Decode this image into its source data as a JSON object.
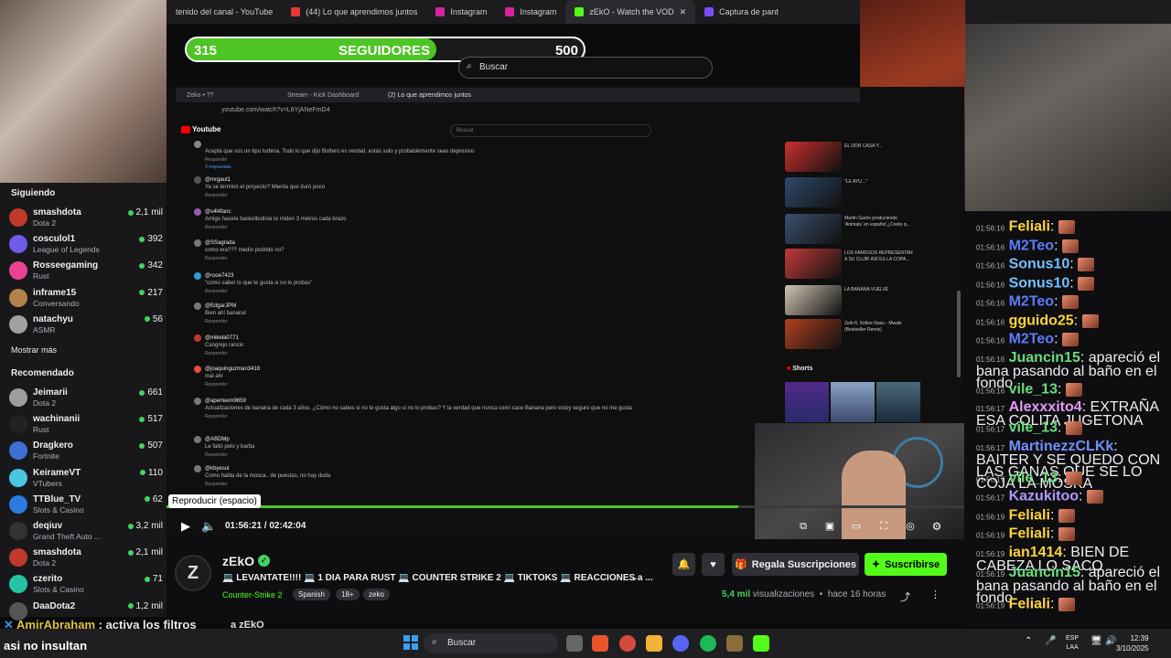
{
  "browser_tabs": [
    "tenido del canal - YouTube",
    "(44) Lo que aprendimos juntos",
    "Instagram",
    "Instagram",
    "zEkO - Watch the VOD",
    "Captura de pant"
  ],
  "follower_goal": {
    "current": "315",
    "label": "SEGUIDORES",
    "target": "500",
    "progress": 0.63
  },
  "top_search_placeholder": "Buscar",
  "sidebar": {
    "following_title": "Siguiendo",
    "following": [
      {
        "name": "smashdota",
        "game": "Dota 2",
        "viewers": "2,1 mil",
        "color": "#c0392b"
      },
      {
        "name": "cosculol1",
        "game": "League of Legends",
        "viewers": "392",
        "color": "#6c5ce7"
      },
      {
        "name": "Rosseegaming",
        "game": "Rust",
        "viewers": "342",
        "color": "#e84393"
      },
      {
        "name": "inframe15",
        "game": "Conversando",
        "viewers": "217",
        "color": "#b2824a"
      },
      {
        "name": "natachyu",
        "game": "ASMR",
        "viewers": "56",
        "color": "#a0a0a0"
      }
    ],
    "show_more": "Mostrar más",
    "recommended_title": "Recomendado",
    "recommended": [
      {
        "name": "Jeimarii",
        "game": "Dota 2",
        "viewers": "661",
        "color": "#9e9e9e"
      },
      {
        "name": "wachinanii",
        "game": "Rust",
        "viewers": "517",
        "color": "#222"
      },
      {
        "name": "Dragkero",
        "game": "Fortnite",
        "viewers": "507",
        "color": "#3d6fd6"
      },
      {
        "name": "KeirameVT",
        "game": "VTubers",
        "viewers": "110",
        "color": "#4ac6e0"
      },
      {
        "name": "TTBlue_TV",
        "game": "Slots & Casino",
        "viewers": "62",
        "color": "#2d7be0"
      },
      {
        "name": "deqiuv",
        "game": "Grand Theft Auto ...",
        "viewers": "3,2 mil",
        "color": "#333"
      },
      {
        "name": "smashdota",
        "game": "Dota 2",
        "viewers": "2,1 mil",
        "color": "#c0392b"
      },
      {
        "name": "czerito",
        "game": "Slots & Casino",
        "viewers": "71",
        "color": "#27c3a6"
      },
      {
        "name": "DaaDota2",
        "game": "",
        "viewers": "1,2 mil",
        "color": "#555"
      }
    ]
  },
  "youtube": {
    "tabs": [
      "Zeko • ??",
      "Stream - Kick Dashboard",
      "(2) Lo que aprendimos juntos"
    ],
    "url": "youtube.com/watch?v=L6YjANeFmD4",
    "logo": "Youtube",
    "search": "Buscar",
    "comments": [
      {
        "user": "",
        "text": "Aceptá que sos un tipo turbina. Todo lo que dijo Bottero es verdad, estás solo y probablemente seas depresivo",
        "color": "#888"
      },
      {
        "user": "@mrgaut1",
        "text": "Ya se terminó el proyecto? Mierda que duró poco",
        "color": "#555"
      },
      {
        "user": "@s4l4fanc",
        "text": "Amigo hacete basketbolista te miden 3 metros cada brazo",
        "color": "#9b59b6"
      },
      {
        "user": "@SSagrada",
        "text": "como era??? medio podrido no?",
        "color": "#777"
      },
      {
        "user": "@rooe7423",
        "text": "\"como saber lo que te gusta si no lo probas\"",
        "color": "#3498db"
      },
      {
        "user": "@EdgarJPM",
        "text": "Bien ahí banana!",
        "color": "#777"
      },
      {
        "user": "@mikela0771",
        "text": "Cangrejo rancio",
        "color": "#c0392b"
      },
      {
        "user": "@joaquinguzman3418",
        "text": "mal ahí",
        "color": "#e74c3c"
      },
      {
        "user": "@aperteem9659",
        "text": "Actualizaciones de banana de cada 3 años. ¿Cómo no sabes si no te gusta algo si no lo probas? Y la verdad que nunca comí cace Banana pero estoy seguro que no me gusta",
        "color": "#777"
      },
      {
        "user": "@ABDMp",
        "text": "Le faltó pelo y barba",
        "color": "#777"
      },
      {
        "user": "@kbyesul",
        "text": "Como habla de la mosca.. de puestas, no hay duda",
        "color": "#777"
      }
    ],
    "reply_label": "Responder",
    "replies_label": "3 respuestas",
    "shorts_label": "Shorts",
    "sidebar_videos": [
      {
        "title": "EL DOR CASA Y...",
        "color": "#c9302c"
      },
      {
        "title": "\"LE AYU...\"",
        "color": "#2d4a6b"
      },
      {
        "title": "Martin Garrix produciendo 'Animals' en español ¿Creés q...",
        "color": "#3a5070"
      },
      {
        "title": "LOS FAMOSOS REPRESENTAN A SU CLUB! ASÍ ES LA COPA...",
        "color": "#c23a3a"
      },
      {
        "title": "LA BANANA VUELVE",
        "color": "#d0c7b3"
      },
      {
        "title": "Zeib ft. Sofiee Nasu - Mwaki (Bestseller Remix)",
        "color": "#b04020"
      }
    ]
  },
  "player": {
    "tooltip": "Reproducir (espacio)",
    "time": "01:56:21 / 02:42:04",
    "progress": 0.717
  },
  "channel": {
    "name": "zEkO",
    "logo_letter": "Z",
    "title": "💻 LEVANTATE!!!! 💻 1 DIA PARA RUST 💻 COUNTER STRIKE 2 💻 TIKTOKS 💻 REACCIONES a ...",
    "category": "Counter-Strike 2",
    "tags": [
      "Spanish",
      "18+",
      "zeko"
    ],
    "views_value": "5,4 mil",
    "views_label": "visualizaciones",
    "ago": "hace 16 horas",
    "gift_label": "Regala Suscripciones",
    "subscribe_label": "Suscribirse",
    "accent": "#53fc18"
  },
  "chat": [
    {
      "ts": "01:56:16",
      "user": "Feliali",
      "color": "#ffd43b",
      "text": "",
      "emote": true
    },
    {
      "ts": "01:56:16",
      "user": "M2Teo",
      "color": "#5c7cfa",
      "text": "",
      "emote": true
    },
    {
      "ts": "01:56:16",
      "user": "Sonus10",
      "color": "#74c0fc",
      "text": "",
      "emote": true
    },
    {
      "ts": "01:56:16",
      "user": "Sonus10",
      "color": "#74c0fc",
      "text": "",
      "emote": true
    },
    {
      "ts": "01:56:16",
      "user": "M2Teo",
      "color": "#5c7cfa",
      "text": "",
      "emote": true
    },
    {
      "ts": "01:56:16",
      "user": "gguido25",
      "color": "#ffd43b",
      "text": "",
      "emote": true
    },
    {
      "ts": "01:56:16",
      "user": "M2Teo",
      "color": "#5c7cfa",
      "text": "",
      "emote": true
    },
    {
      "ts": "01:56:16",
      "user": "Juancin15",
      "color": "#69db7c",
      "text": "apareció el bana pasando al baño en el fondo",
      "emote": false
    },
    {
      "ts": "01:56:16",
      "user": "vile_13",
      "color": "#69db7c",
      "text": "",
      "emote": true
    },
    {
      "ts": "01:56:17",
      "user": "Alexxxito4",
      "color": "#e599f7",
      "text": "EXTRAÑA ESA COLITA JUGETONA",
      "emote": false
    },
    {
      "ts": "01:56:17",
      "user": "vile_13",
      "color": "#69db7c",
      "text": "",
      "emote": true
    },
    {
      "ts": "01:56:17",
      "user": "MartinezzCLKk",
      "color": "#748ffc",
      "text": "BAITER Y SE QUEDO CON LAS GANAS QUE SE LO COJA LA MOSKA",
      "emote": false
    },
    {
      "ts": "01:56:17",
      "user": "vile_13",
      "color": "#69db7c",
      "text": "",
      "emote": true
    },
    {
      "ts": "01:56:17",
      "user": "Kazukitoo",
      "color": "#b197fc",
      "text": "",
      "emote": true
    },
    {
      "ts": "01:56:19",
      "user": "Feliali",
      "color": "#ffd43b",
      "text": "",
      "emote": true
    },
    {
      "ts": "01:56:19",
      "user": "Feliali",
      "color": "#ffd43b",
      "text": "",
      "emote": true
    },
    {
      "ts": "01:56:19",
      "user": "ian1414",
      "color": "#ffd43b",
      "text": "BIEN DE CABEZA LO SACO",
      "emote": false
    },
    {
      "ts": "01:56:19",
      "user": "Juancin15",
      "color": "#69db7c",
      "text": "apareció el bana pasando al baño en el fondo",
      "emote": false
    },
    {
      "ts": "01:56:19",
      "user": "Feliali",
      "color": "#ffd43b",
      "text": "",
      "emote": true
    }
  ],
  "overlay": {
    "user": "AmirAbraham",
    "message": ": activa los filtros",
    "line2": "asi no insultan",
    "behind": "a zEkO"
  },
  "taskbar": {
    "search": "Buscar",
    "lang1": "ESP",
    "lang2": "LAA",
    "time": "12:39",
    "date": "3/10/2025"
  }
}
